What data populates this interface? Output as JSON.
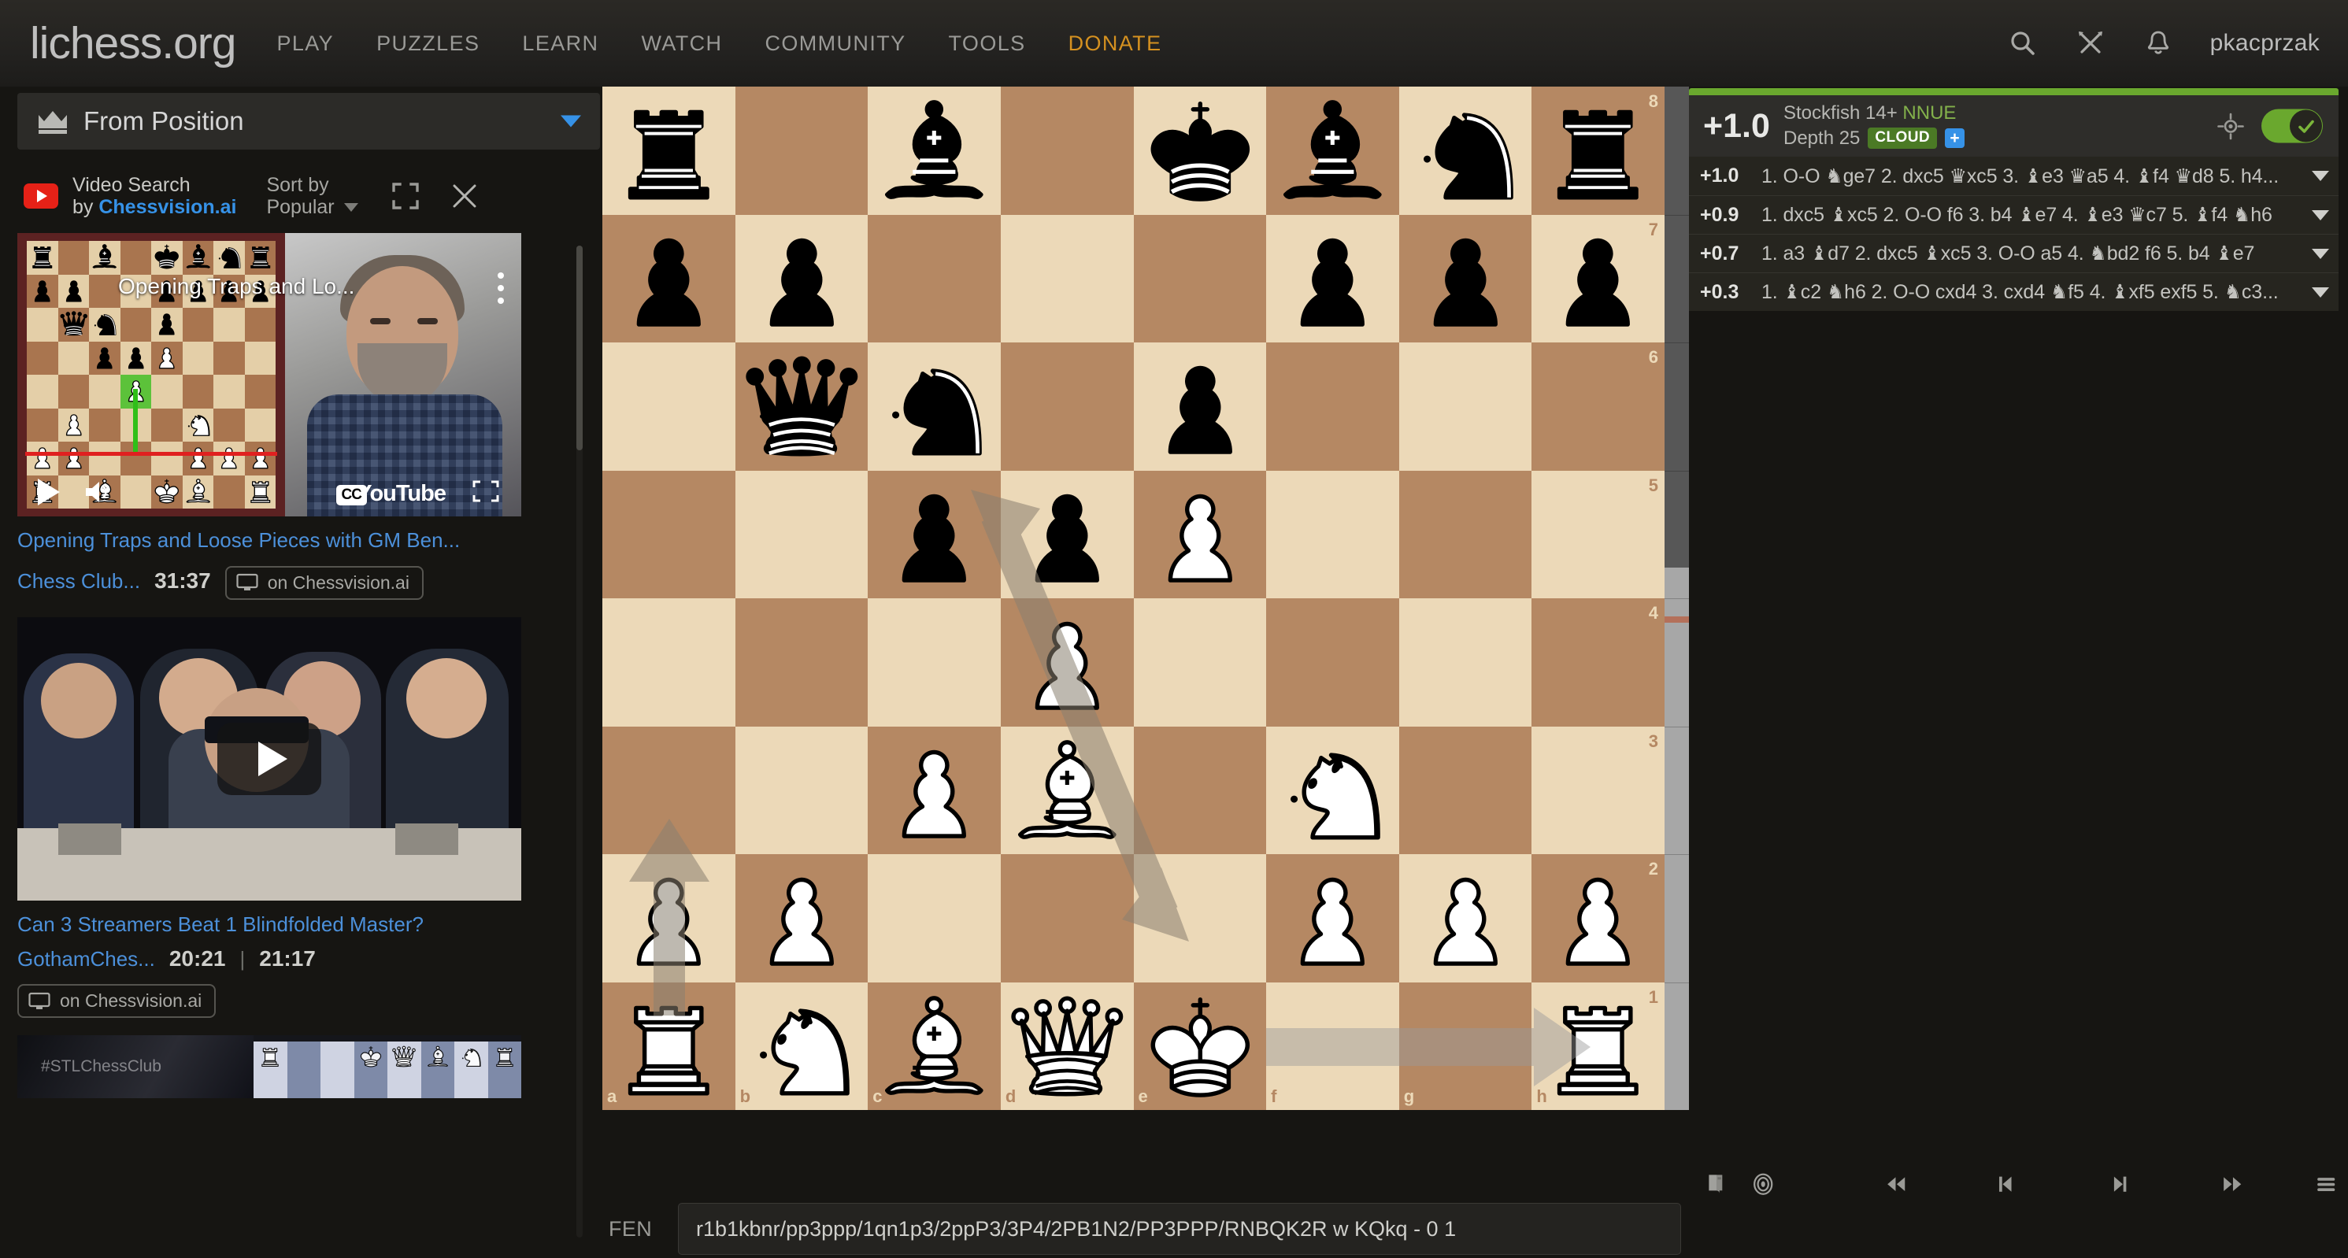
{
  "header": {
    "logo": "lichess.org",
    "nav": [
      {
        "label": "PLAY"
      },
      {
        "label": "PUZZLES"
      },
      {
        "label": "LEARN"
      },
      {
        "label": "WATCH"
      },
      {
        "label": "COMMUNITY"
      },
      {
        "label": "TOOLS"
      },
      {
        "label": "DONATE"
      }
    ],
    "icons": [
      "search-icon",
      "challenge-swords-icon",
      "notifications-bell-icon"
    ],
    "username": "pkacprzak",
    "donate_color": "#d59120"
  },
  "sidebar": {
    "chapter": {
      "icon": "crown-icon",
      "title": "From Position",
      "caret": "chevron-down-icon",
      "caret_color": "#3692e7"
    },
    "video_search": {
      "provider_icon": "youtube-icon",
      "title_line1": "Video Search",
      "title_line2_prefix": "by ",
      "title_line2_brand": "Chessvision.ai",
      "sort_label": "Sort by",
      "sort_value": "Popular",
      "expand_icon": "expand-icon",
      "close_icon": "close-icon"
    },
    "videos": [
      {
        "title": "Opening Traps and Loose Pieces with GM Ben...",
        "channel": "Chess Club...",
        "duration": "31:37",
        "chip_label": "on Chessvision.ai",
        "player_title": "Opening Traps and Lo...",
        "player_brand": "YouTube",
        "player_cc": "CC",
        "state": "playing"
      },
      {
        "title": "Can 3 Streamers Beat 1 Blindfolded Master?",
        "channel": "GothamChes...",
        "duration": "20:21",
        "timestamp": "21:17",
        "separator": "|",
        "chip_label": "on Chessvision.ai",
        "state": "thumbnail"
      },
      {
        "watermark": "#STLChessClub",
        "state": "thumbnail-cropped"
      }
    ]
  },
  "board": {
    "orientation": "white",
    "fen": "r1b1kbnr/pp3ppp/1qn1p3/2ppP3/3P4/2PB1N2/PP3PPP/RNBQK2R w KQkq - 0 1",
    "light_square_color": "#ecd9b8",
    "dark_square_color": "#b58863",
    "files": [
      "a",
      "b",
      "c",
      "d",
      "e",
      "f",
      "g",
      "h"
    ],
    "ranks": [
      "8",
      "7",
      "6",
      "5",
      "4",
      "3",
      "2",
      "1"
    ],
    "pieces": [
      {
        "square": "a8",
        "piece": "br"
      },
      {
        "square": "c8",
        "piece": "bb"
      },
      {
        "square": "e8",
        "piece": "bk"
      },
      {
        "square": "f8",
        "piece": "bb"
      },
      {
        "square": "g8",
        "piece": "bn"
      },
      {
        "square": "h8",
        "piece": "br"
      },
      {
        "square": "a7",
        "piece": "bp"
      },
      {
        "square": "b7",
        "piece": "bp"
      },
      {
        "square": "f7",
        "piece": "bp"
      },
      {
        "square": "g7",
        "piece": "bp"
      },
      {
        "square": "h7",
        "piece": "bp"
      },
      {
        "square": "b6",
        "piece": "bq"
      },
      {
        "square": "c6",
        "piece": "bn"
      },
      {
        "square": "e6",
        "piece": "bp"
      },
      {
        "square": "c5",
        "piece": "bp"
      },
      {
        "square": "d5",
        "piece": "bp"
      },
      {
        "square": "e5",
        "piece": "wp"
      },
      {
        "square": "d4",
        "piece": "wp"
      },
      {
        "square": "c3",
        "piece": "wp"
      },
      {
        "square": "d3",
        "piece": "wb"
      },
      {
        "square": "f3",
        "piece": "wn"
      },
      {
        "square": "a2",
        "piece": "wp"
      },
      {
        "square": "b2",
        "piece": "wp"
      },
      {
        "square": "f2",
        "piece": "wp"
      },
      {
        "square": "g2",
        "piece": "wp"
      },
      {
        "square": "h2",
        "piece": "wp"
      },
      {
        "square": "a1",
        "piece": "wr"
      },
      {
        "square": "b1",
        "piece": "wn"
      },
      {
        "square": "c1",
        "piece": "wb"
      },
      {
        "square": "d1",
        "piece": "wq"
      },
      {
        "square": "e1",
        "piece": "wk"
      },
      {
        "square": "h1",
        "piece": "wr"
      }
    ],
    "arrows": [
      {
        "from": "e1",
        "to": "h1",
        "kind": "castle-highlight",
        "color": "#9a9a9a"
      },
      {
        "from": "c5",
        "to": "d3",
        "kind": "double-head",
        "color": "#8a8070"
      },
      {
        "from": "a2",
        "to": "a3",
        "kind": "single",
        "color": "#8a8070"
      }
    ],
    "eval_gauge": {
      "white_share_percent": 53,
      "black_share_percent": 47,
      "tick_color": "#b4705a"
    }
  },
  "engine": {
    "score": "+1.0",
    "name": "Stockfish 14+",
    "nnue_label": "NNUE",
    "depth_label": "Depth 25",
    "cloud_badge": "CLOUD",
    "plus_badge": "+",
    "crosshair_icon": "crosshair-icon",
    "toggle_state": "on",
    "accent_green": "#6aa82e",
    "variations": [
      {
        "score": "+1.0",
        "moves": "1. O-O ♞ge7 2. dxc5 ♛xc5 3. ♝e3 ♛a5 4. ♝f4 ♛d8 5. h4..."
      },
      {
        "score": "+0.9",
        "moves": "1. dxc5 ♝xc5 2. O-O f6 3. b4 ♝e7 4. ♝e3 ♛c7 5. ♝f4 ♞h6"
      },
      {
        "score": "+0.7",
        "moves": "1. a3 ♝d7 2. dxc5 ♝xc5 3. O-O a5 4. ♞bd2 f6 5. b4 ♝e7"
      },
      {
        "score": "+0.3",
        "moves": "1. ♝c2 ♞h6 2. O-O cxd4 3. cxd4 ♞f5 4. ♝xf5 exf5 5. ♞c3..."
      }
    ]
  },
  "toolbar": {
    "buttons": [
      {
        "name": "opening-explorer",
        "icon": "book-icon"
      },
      {
        "name": "practice",
        "icon": "target-icon"
      },
      {
        "name": "first-move",
        "icon": "skip-to-start-icon"
      },
      {
        "name": "previous-move",
        "icon": "step-back-icon"
      },
      {
        "name": "next-move",
        "icon": "step-forward-icon"
      },
      {
        "name": "last-move",
        "icon": "skip-to-end-icon"
      },
      {
        "name": "menu",
        "icon": "hamburger-menu-icon"
      }
    ]
  },
  "fen_bar": {
    "label": "FEN",
    "value": "r1b1kbnr/pp3ppp/1qn1p3/2ppP3/3P4/2PB1N2/PP3PPP/RNBQK2R w KQkq - 0 1",
    "placeholder": "FEN"
  }
}
